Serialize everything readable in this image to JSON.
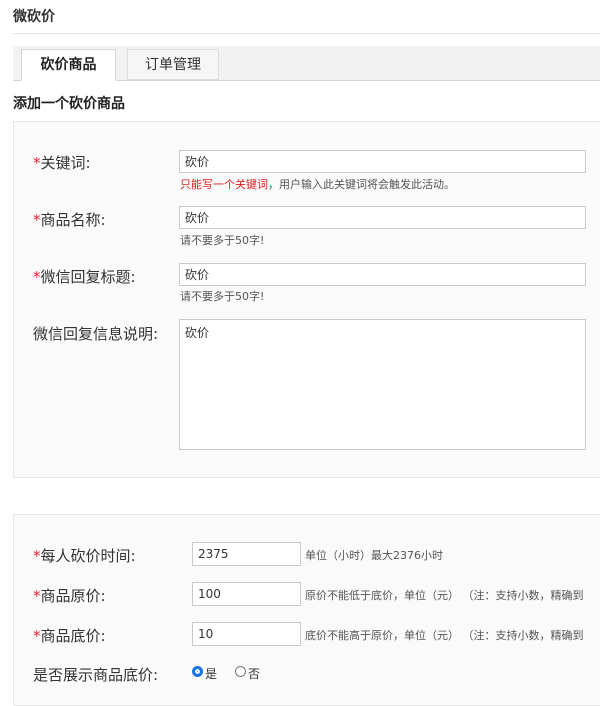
{
  "page": {
    "title": "微砍价"
  },
  "tabs": [
    {
      "label": "砍价商品"
    },
    {
      "label": "订单管理"
    }
  ],
  "section": {
    "title": "添加一个砍价商品"
  },
  "form1": {
    "keyword": {
      "label": "关键词:",
      "value": "砍价",
      "hint_red": "只能写一个关键词",
      "hint_rest": "，用户输入此关键词将会触发此活动。"
    },
    "name": {
      "label": "商品名称:",
      "value": "砍价",
      "hint": "请不要多于50字!"
    },
    "reply_title": {
      "label": "微信回复标题:",
      "value": "砍价",
      "hint": "请不要多于50字!"
    },
    "reply_desc": {
      "label": "微信回复信息说明:",
      "value": "砍价"
    }
  },
  "form2": {
    "time": {
      "label": "每人砍价时间:",
      "value": "2375",
      "hint": "单位（小时）最大2376小时"
    },
    "orig_price": {
      "label": "商品原价:",
      "value": "100",
      "hint": "原价不能低于底价，单位（元）  （注：支持小数，精确到"
    },
    "base_price": {
      "label": "商品底价:",
      "value": "10",
      "hint": "底价不能高于原价，单位（元）  （注：支持小数，精确到"
    },
    "show_base": {
      "label": "是否展示商品底价:",
      "yes": "是",
      "no": "否",
      "selected": "yes"
    }
  },
  "colors": {
    "required": "#e22233",
    "hint_red": "#e02020",
    "radio_on": "#1a73e8"
  }
}
